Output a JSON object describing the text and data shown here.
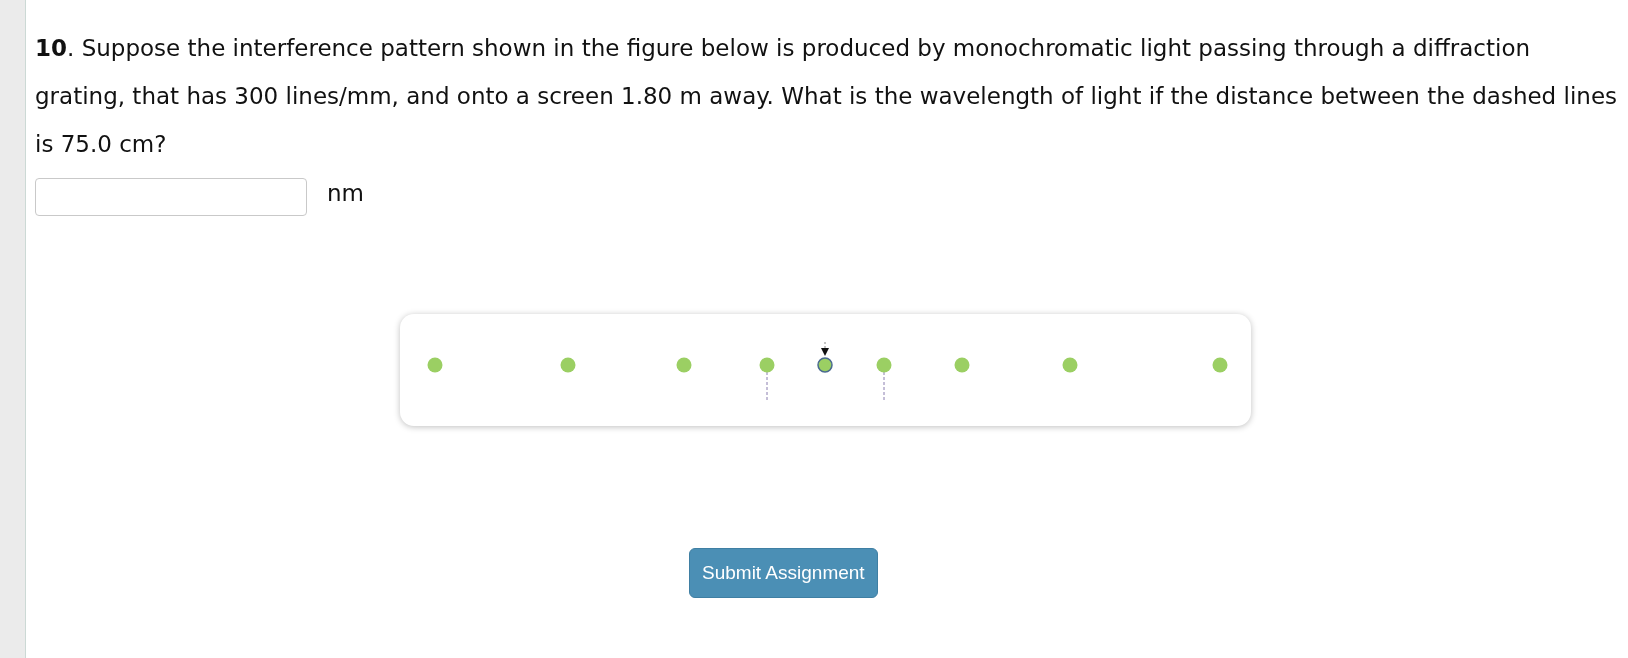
{
  "question": {
    "number": "10",
    "text": ". Suppose the interference pattern shown in the figure below is produced by monochromatic light passing through a diffraction grating, that has 300 lines/mm, and onto a screen 1.80 m away. What is the wavelength of light if the distance between the dashed lines is 75.0 cm?"
  },
  "answer": {
    "unit": "nm"
  },
  "submit_button": "Submit Assignment"
}
